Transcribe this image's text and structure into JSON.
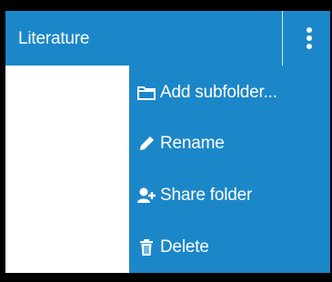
{
  "header": {
    "title": "Literature"
  },
  "menu": {
    "items": [
      {
        "label": "Add subfolder...",
        "icon": "folder-icon"
      },
      {
        "label": "Rename",
        "icon": "pencil-icon"
      },
      {
        "label": "Share folder",
        "icon": "add-user-icon"
      },
      {
        "label": "Delete",
        "icon": "trash-icon"
      }
    ]
  },
  "colors": {
    "accent": "#1b87c9",
    "text": "#ffffff",
    "panel": "#ffffff"
  }
}
